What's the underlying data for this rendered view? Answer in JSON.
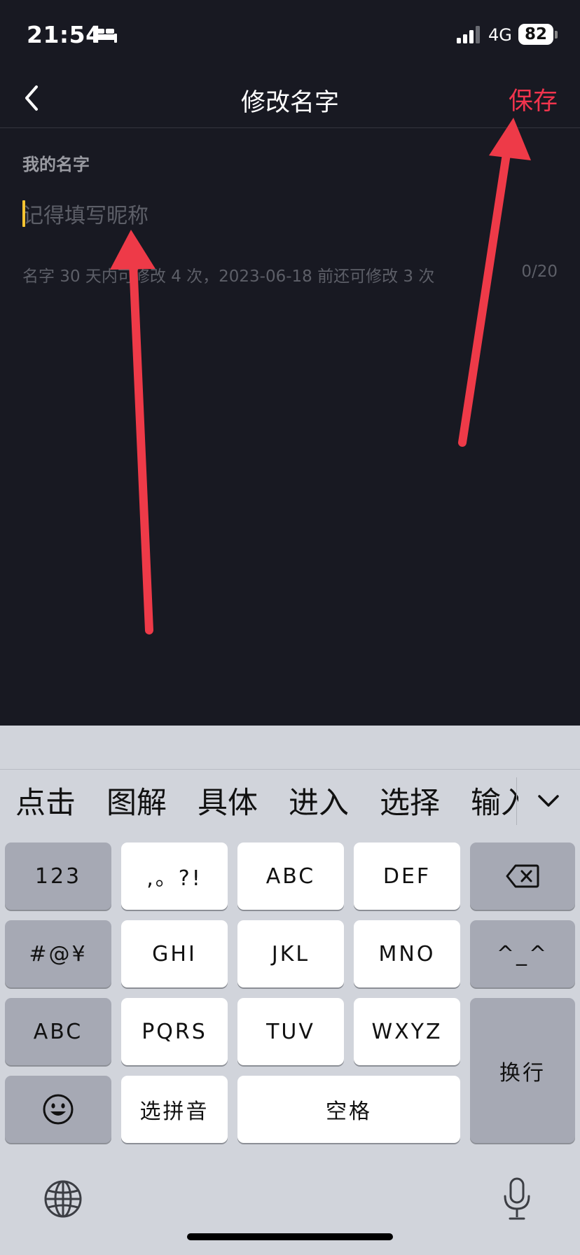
{
  "status_bar": {
    "time": "21:54",
    "network": "4G",
    "battery": "82"
  },
  "nav": {
    "title": "修改名字",
    "save_label": "保存"
  },
  "form": {
    "label": "我的名字",
    "placeholder": "记得填写昵称",
    "value": "",
    "hint": "名字 30 天内可修改 4 次，2023-06-18 前还可修改 3 次",
    "counter": "0/20"
  },
  "keyboard": {
    "candidates": [
      "点击",
      "图解",
      "具体",
      "进入",
      "选择",
      "输入"
    ],
    "keys": {
      "num": "123",
      "punct": ",。?!",
      "abc_t9": "ABC",
      "def": "DEF",
      "symbols": "#@¥",
      "ghi": "GHI",
      "jkl": "JKL",
      "mno": "MNO",
      "kaomoji": "^_^",
      "abc_switch": "ABC",
      "pqrs": "PQRS",
      "tuv": "TUV",
      "wxyz": "WXYZ",
      "return": "换行",
      "select_pinyin": "选拼音",
      "space": "空格"
    }
  },
  "colors": {
    "background": "#181922",
    "accent": "#f1344d",
    "caret": "#f5c431",
    "annotation": "#ee3a48"
  }
}
